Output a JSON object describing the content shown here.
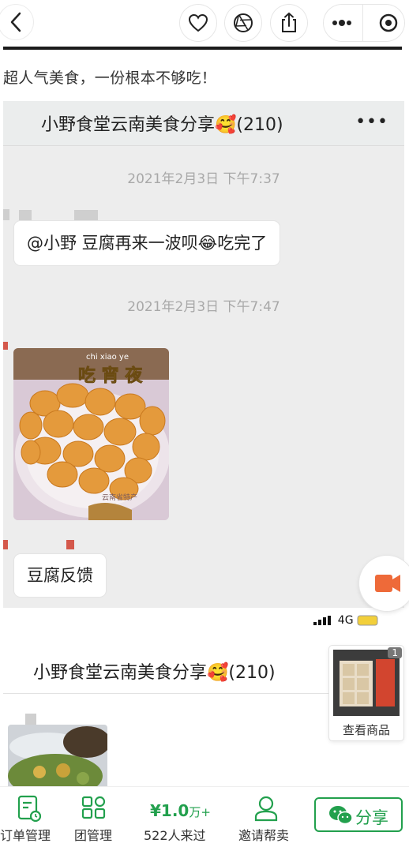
{
  "topbar": {
    "icons": [
      "back-icon",
      "heart-icon",
      "aperture-icon",
      "share-upload-icon",
      "more-dots-icon",
      "target-icon"
    ]
  },
  "intro_text": "超人气美食，一份根本不够吃！",
  "chat1": {
    "title": "小野食堂云南美食分享🥰(210)",
    "more": "•••",
    "messages": [
      {
        "time": "2021年2月3日 下午7:37",
        "text": "@小野 豆腐再来一波呗😂吃完了"
      },
      {
        "time": "2021年2月3日 下午7:47",
        "image_caption": "chi xiao ye 吃 宵 夜",
        "image_sub": "云南省特产"
      },
      {
        "text": "豆腐反馈"
      }
    ]
  },
  "chat2": {
    "status": "4G",
    "title": "小野食堂云南美食分享🥰(210)"
  },
  "product_card": {
    "badge": "1",
    "label": "查看商品"
  },
  "bottom_bar": {
    "order_label": "订单管理",
    "group_label": "团管理",
    "price_value": "¥1.0",
    "price_unit": "万+",
    "visitors_label": "522人来过",
    "invite_label": "邀请帮卖",
    "share_label": "分享",
    "accent_color": "#22a04d"
  }
}
